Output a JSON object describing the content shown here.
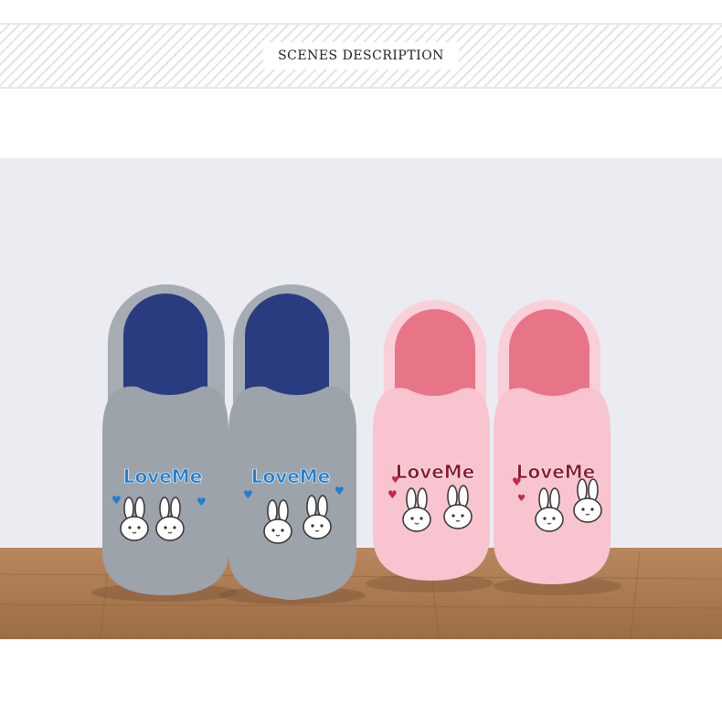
{
  "header": {
    "title": "SCENES DESCRIPTION"
  },
  "photo": {
    "subject": "two pairs of plush bunny slippers (gray with blue lining, pink with rose lining) standing against a white wall on a wooden floor",
    "slipper_text": "LoveMe",
    "colors": {
      "wall": "#ebebf2",
      "floor": "#a9784e",
      "gray_slipper": "#9ca3ab",
      "blue_lining": "#2a3c80",
      "pink_slipper": "#f7c4cf",
      "rose_lining": "#e87488"
    }
  }
}
